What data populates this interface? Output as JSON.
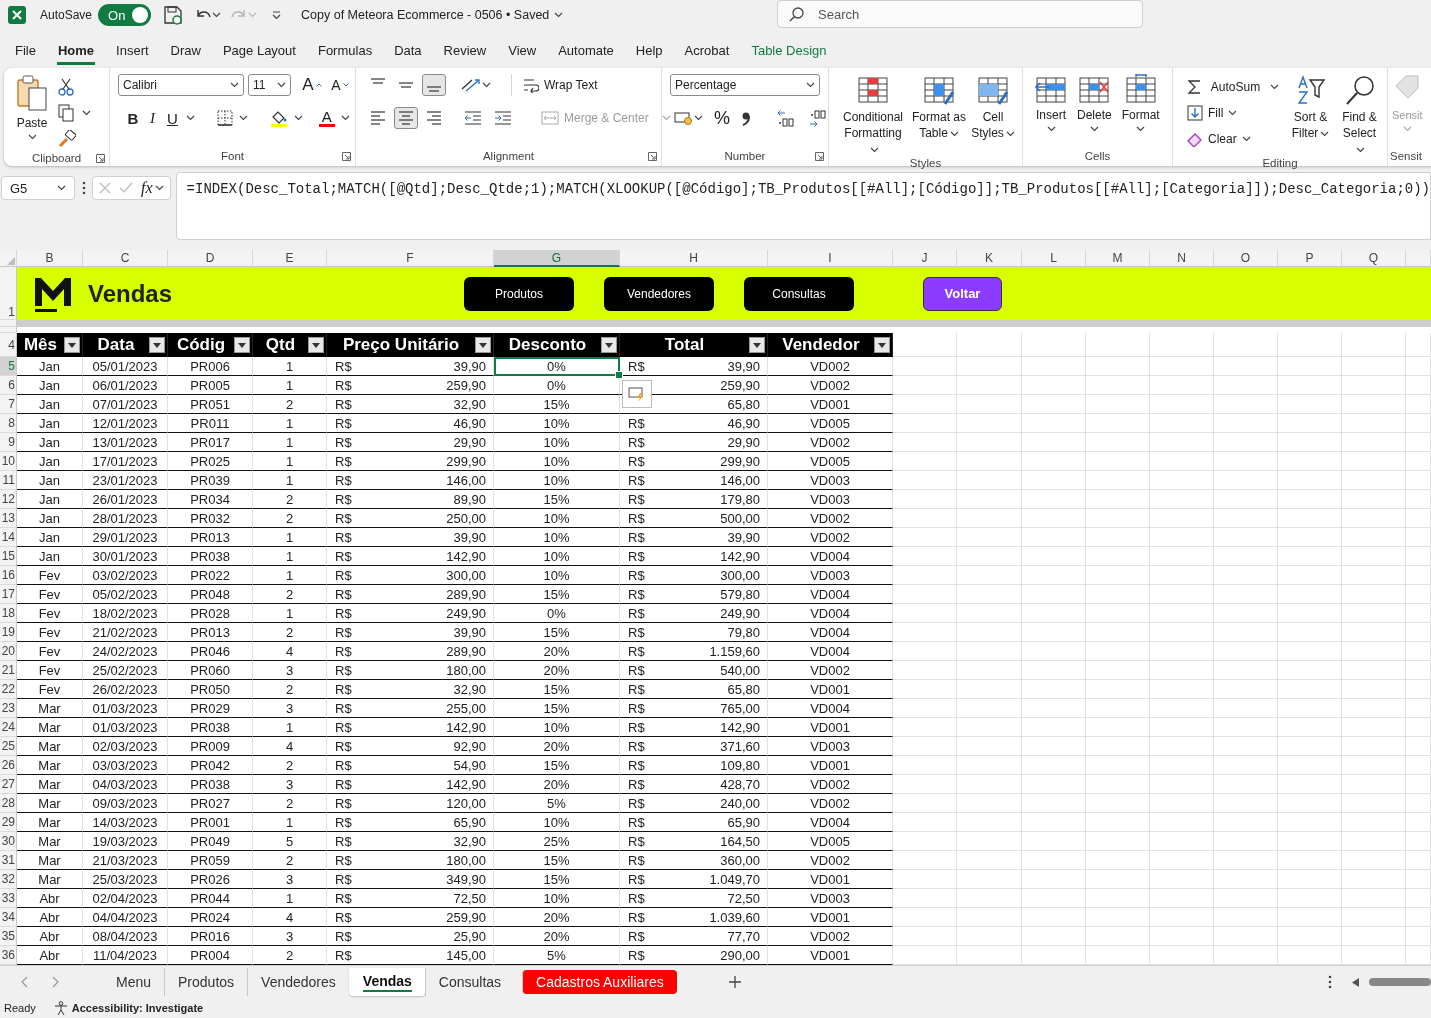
{
  "title_bar": {
    "app_label": "AutoSave",
    "autosave_on": true,
    "autosave_state": "On",
    "redo_disabled": true,
    "document_title": "Copy of Meteora Ecommerce - 0506 • Saved",
    "search": {
      "placeholder": "Search"
    }
  },
  "ribbon_tabs": [
    {
      "label": "File",
      "selected": false,
      "kind": "standard"
    },
    {
      "label": "Home",
      "selected": true,
      "kind": "standard"
    },
    {
      "label": "Insert",
      "selected": false,
      "kind": "standard"
    },
    {
      "label": "Draw",
      "selected": false,
      "kind": "standard"
    },
    {
      "label": "Page Layout",
      "selected": false,
      "kind": "standard"
    },
    {
      "label": "Formulas",
      "selected": false,
      "kind": "standard"
    },
    {
      "label": "Data",
      "selected": false,
      "kind": "standard"
    },
    {
      "label": "Review",
      "selected": false,
      "kind": "standard"
    },
    {
      "label": "View",
      "selected": false,
      "kind": "standard"
    },
    {
      "label": "Automate",
      "selected": false,
      "kind": "standard"
    },
    {
      "label": "Help",
      "selected": false,
      "kind": "standard"
    },
    {
      "label": "Acrobat",
      "selected": false,
      "kind": "standard"
    },
    {
      "label": "Table Design",
      "selected": false,
      "kind": "contextual"
    }
  ],
  "ribbon": {
    "clipboard": {
      "label": "Clipboard",
      "paste": "Paste"
    },
    "font": {
      "label": "Font",
      "font_name": "Calibri",
      "font_size": "11",
      "grow": "A",
      "shrink": "A",
      "styles": [
        "B",
        "I",
        "U"
      ],
      "font_color": "A"
    },
    "alignment": {
      "label": "Alignment",
      "vertical": [
        {
          "selected": false
        },
        {
          "selected": false
        },
        {
          "selected": true
        }
      ],
      "horizontal": [
        {
          "selected": false
        },
        {
          "selected": true
        },
        {
          "selected": false
        }
      ],
      "wrap_text": "Wrap Text",
      "merge_center": "Merge & Center",
      "merge_disabled": true
    },
    "number": {
      "label": "Number",
      "format": "Percentage",
      "percent": "%"
    },
    "styles": {
      "label": "Styles",
      "buttons": [
        "Conditional Formatting",
        "Format as Table",
        "Cell Styles"
      ]
    },
    "cells": {
      "label": "Cells",
      "buttons": [
        "Insert",
        "Delete",
        "Format"
      ]
    },
    "editing": {
      "label": "Editing",
      "small_buttons": [
        "AutoSum",
        "Fill",
        "Clear"
      ],
      "buttons": [
        "Sort & Filter",
        "Find & Select"
      ]
    },
    "sensitivity": {
      "label": "Sensit",
      "button": "Sensit",
      "disabled": true
    }
  },
  "formula_bar": {
    "name_box": "G5",
    "fx": "fx",
    "formula": "=INDEX(Desc_Total;MATCH([@Qtd];Desc_Qtde;1);MATCH(XLOOKUP([@Código];TB_Produtos[[#All];[Código]];TB_Produtos[[#All];[Categoria]]);Desc_Categoria;0))"
  },
  "columns": [
    {
      "letter": "B",
      "selected": false
    },
    {
      "letter": "C",
      "selected": false
    },
    {
      "letter": "D",
      "selected": false
    },
    {
      "letter": "E",
      "selected": false
    },
    {
      "letter": "F",
      "selected": false
    },
    {
      "letter": "G",
      "selected": true
    },
    {
      "letter": "H",
      "selected": false
    },
    {
      "letter": "I",
      "selected": false
    },
    {
      "letter": "J",
      "selected": false
    },
    {
      "letter": "K",
      "selected": false
    },
    {
      "letter": "L",
      "selected": false
    },
    {
      "letter": "M",
      "selected": false
    },
    {
      "letter": "N",
      "selected": false
    },
    {
      "letter": "O",
      "selected": false
    },
    {
      "letter": "P",
      "selected": false
    },
    {
      "letter": "Q",
      "selected": false
    }
  ],
  "banner": {
    "row": "1",
    "title": "Vendas",
    "buttons": [
      {
        "label": "Produtos",
        "kind": "nav"
      },
      {
        "label": "Vendedores",
        "kind": "nav"
      },
      {
        "label": "Consultas",
        "kind": "nav"
      },
      {
        "label": "Voltar",
        "kind": "back"
      }
    ]
  },
  "table": {
    "header_row": "4",
    "headers": [
      "Mês",
      "Data",
      "Códig",
      "Qtd",
      "Preço Unitário",
      "Desconto",
      "Total",
      "Vendedor"
    ],
    "rows": [
      {
        "row": "5",
        "month": "Jan",
        "date": "05/01/2023",
        "code": "PR006",
        "qty": "1",
        "price_currency": "R$",
        "price": "39,90",
        "discount": "0%",
        "total_currency": "R$",
        "total": "39,90",
        "seller": "VD002",
        "selected": true
      },
      {
        "row": "6",
        "month": "Jan",
        "date": "06/01/2023",
        "code": "PR005",
        "qty": "1",
        "price_currency": "R$",
        "price": "259,90",
        "discount": "0%",
        "total": "259,90",
        "seller": "VD002",
        "selected": false
      },
      {
        "row": "7",
        "month": "Jan",
        "date": "07/01/2023",
        "code": "PR051",
        "qty": "2",
        "price_currency": "R$",
        "price": "32,90",
        "discount": "15%",
        "total": "65,80",
        "seller": "VD001",
        "selected": false
      },
      {
        "row": "8",
        "month": "Jan",
        "date": "12/01/2023",
        "code": "PR011",
        "qty": "1",
        "price_currency": "R$",
        "price": "46,90",
        "discount": "10%",
        "total_currency": "R$",
        "total": "46,90",
        "seller": "VD005",
        "selected": false
      },
      {
        "row": "9",
        "month": "Jan",
        "date": "13/01/2023",
        "code": "PR017",
        "qty": "1",
        "price_currency": "R$",
        "price": "29,90",
        "discount": "10%",
        "total_currency": "R$",
        "total": "29,90",
        "seller": "VD002",
        "selected": false
      },
      {
        "row": "10",
        "month": "Jan",
        "date": "17/01/2023",
        "code": "PR025",
        "qty": "1",
        "price_currency": "R$",
        "price": "299,90",
        "discount": "10%",
        "total_currency": "R$",
        "total": "299,90",
        "seller": "VD005",
        "selected": false
      },
      {
        "row": "11",
        "month": "Jan",
        "date": "23/01/2023",
        "code": "PR039",
        "qty": "1",
        "price_currency": "R$",
        "price": "146,00",
        "discount": "10%",
        "total_currency": "R$",
        "total": "146,00",
        "seller": "VD003",
        "selected": false
      },
      {
        "row": "12",
        "month": "Jan",
        "date": "26/01/2023",
        "code": "PR034",
        "qty": "2",
        "price_currency": "R$",
        "price": "89,90",
        "discount": "15%",
        "total_currency": "R$",
        "total": "179,80",
        "seller": "VD003",
        "selected": false
      },
      {
        "row": "13",
        "month": "Jan",
        "date": "28/01/2023",
        "code": "PR032",
        "qty": "2",
        "price_currency": "R$",
        "price": "250,00",
        "discount": "10%",
        "total_currency": "R$",
        "total": "500,00",
        "seller": "VD002",
        "selected": false
      },
      {
        "row": "14",
        "month": "Jan",
        "date": "29/01/2023",
        "code": "PR013",
        "qty": "1",
        "price_currency": "R$",
        "price": "39,90",
        "discount": "10%",
        "total_currency": "R$",
        "total": "39,90",
        "seller": "VD002",
        "selected": false
      },
      {
        "row": "15",
        "month": "Jan",
        "date": "30/01/2023",
        "code": "PR038",
        "qty": "1",
        "price_currency": "R$",
        "price": "142,90",
        "discount": "10%",
        "total_currency": "R$",
        "total": "142,90",
        "seller": "VD004",
        "selected": false
      },
      {
        "row": "16",
        "month": "Fev",
        "date": "03/02/2023",
        "code": "PR022",
        "qty": "1",
        "price_currency": "R$",
        "price": "300,00",
        "discount": "10%",
        "total_currency": "R$",
        "total": "300,00",
        "seller": "VD003",
        "selected": false
      },
      {
        "row": "17",
        "month": "Fev",
        "date": "05/02/2023",
        "code": "PR048",
        "qty": "2",
        "price_currency": "R$",
        "price": "289,90",
        "discount": "15%",
        "total_currency": "R$",
        "total": "579,80",
        "seller": "VD004",
        "selected": false
      },
      {
        "row": "18",
        "month": "Fev",
        "date": "18/02/2023",
        "code": "PR028",
        "qty": "1",
        "price_currency": "R$",
        "price": "249,90",
        "discount": "0%",
        "total_currency": "R$",
        "total": "249,90",
        "seller": "VD004",
        "selected": false
      },
      {
        "row": "19",
        "month": "Fev",
        "date": "21/02/2023",
        "code": "PR013",
        "qty": "2",
        "price_currency": "R$",
        "price": "39,90",
        "discount": "15%",
        "total_currency": "R$",
        "total": "79,80",
        "seller": "VD004",
        "selected": false
      },
      {
        "row": "20",
        "month": "Fev",
        "date": "24/02/2023",
        "code": "PR046",
        "qty": "4",
        "price_currency": "R$",
        "price": "289,90",
        "discount": "20%",
        "total_currency": "R$",
        "total": "1.159,60",
        "seller": "VD004",
        "selected": false
      },
      {
        "row": "21",
        "month": "Fev",
        "date": "25/02/2023",
        "code": "PR060",
        "qty": "3",
        "price_currency": "R$",
        "price": "180,00",
        "discount": "20%",
        "total_currency": "R$",
        "total": "540,00",
        "seller": "VD002",
        "selected": false
      },
      {
        "row": "22",
        "month": "Fev",
        "date": "26/02/2023",
        "code": "PR050",
        "qty": "2",
        "price_currency": "R$",
        "price": "32,90",
        "discount": "15%",
        "total_currency": "R$",
        "total": "65,80",
        "seller": "VD001",
        "selected": false
      },
      {
        "row": "23",
        "month": "Mar",
        "date": "01/03/2023",
        "code": "PR029",
        "qty": "3",
        "price_currency": "R$",
        "price": "255,00",
        "discount": "15%",
        "total_currency": "R$",
        "total": "765,00",
        "seller": "VD004",
        "selected": false
      },
      {
        "row": "24",
        "month": "Mar",
        "date": "01/03/2023",
        "code": "PR038",
        "qty": "1",
        "price_currency": "R$",
        "price": "142,90",
        "discount": "10%",
        "total_currency": "R$",
        "total": "142,90",
        "seller": "VD001",
        "selected": false
      },
      {
        "row": "25",
        "month": "Mar",
        "date": "02/03/2023",
        "code": "PR009",
        "qty": "4",
        "price_currency": "R$",
        "price": "92,90",
        "discount": "20%",
        "total_currency": "R$",
        "total": "371,60",
        "seller": "VD003",
        "selected": false
      },
      {
        "row": "26",
        "month": "Mar",
        "date": "03/03/2023",
        "code": "PR042",
        "qty": "2",
        "price_currency": "R$",
        "price": "54,90",
        "discount": "15%",
        "total_currency": "R$",
        "total": "109,80",
        "seller": "VD001",
        "selected": false
      },
      {
        "row": "27",
        "month": "Mar",
        "date": "04/03/2023",
        "code": "PR038",
        "qty": "3",
        "price_currency": "R$",
        "price": "142,90",
        "discount": "20%",
        "total_currency": "R$",
        "total": "428,70",
        "seller": "VD002",
        "selected": false
      },
      {
        "row": "28",
        "month": "Mar",
        "date": "09/03/2023",
        "code": "PR027",
        "qty": "2",
        "price_currency": "R$",
        "price": "120,00",
        "discount": "5%",
        "total_currency": "R$",
        "total": "240,00",
        "seller": "VD002",
        "selected": false
      },
      {
        "row": "29",
        "month": "Mar",
        "date": "14/03/2023",
        "code": "PR001",
        "qty": "1",
        "price_currency": "R$",
        "price": "65,90",
        "discount": "10%",
        "total_currency": "R$",
        "total": "65,90",
        "seller": "VD004",
        "selected": false
      },
      {
        "row": "30",
        "month": "Mar",
        "date": "19/03/2023",
        "code": "PR049",
        "qty": "5",
        "price_currency": "R$",
        "price": "32,90",
        "discount": "25%",
        "total_currency": "R$",
        "total": "164,50",
        "seller": "VD005",
        "selected": false
      },
      {
        "row": "31",
        "month": "Mar",
        "date": "21/03/2023",
        "code": "PR059",
        "qty": "2",
        "price_currency": "R$",
        "price": "180,00",
        "discount": "15%",
        "total_currency": "R$",
        "total": "360,00",
        "seller": "VD002",
        "selected": false
      },
      {
        "row": "32",
        "month": "Mar",
        "date": "25/03/2023",
        "code": "PR026",
        "qty": "3",
        "price_currency": "R$",
        "price": "349,90",
        "discount": "15%",
        "total_currency": "R$",
        "total": "1.049,70",
        "seller": "VD001",
        "selected": false
      },
      {
        "row": "33",
        "month": "Abr",
        "date": "02/04/2023",
        "code": "PR044",
        "qty": "1",
        "price_currency": "R$",
        "price": "72,50",
        "discount": "10%",
        "total_currency": "R$",
        "total": "72,50",
        "seller": "VD003",
        "selected": false
      },
      {
        "row": "34",
        "month": "Abr",
        "date": "04/04/2023",
        "code": "PR024",
        "qty": "4",
        "price_currency": "R$",
        "price": "259,90",
        "discount": "20%",
        "total_currency": "R$",
        "total": "1.039,60",
        "seller": "VD001",
        "selected": false
      },
      {
        "row": "35",
        "month": "Abr",
        "date": "08/04/2023",
        "code": "PR016",
        "qty": "3",
        "price_currency": "R$",
        "price": "25,90",
        "discount": "20%",
        "total_currency": "R$",
        "total": "77,70",
        "seller": "VD002",
        "selected": false
      },
      {
        "row": "36",
        "month": "Abr",
        "date": "11/04/2023",
        "code": "PR004",
        "qty": "2",
        "price_currency": "R$",
        "price": "145,00",
        "discount": "5%",
        "total_currency": "R$",
        "total": "290,00",
        "seller": "VD001",
        "selected": false
      }
    ]
  },
  "sheet_tabs": [
    {
      "label": "Menu",
      "selected": false
    },
    {
      "label": "Produtos",
      "selected": false
    },
    {
      "label": "Vendedores",
      "selected": false
    },
    {
      "label": "Vendas",
      "selected": true
    },
    {
      "label": "Consultas",
      "selected": false
    },
    {
      "label": "Cadastros Auxiliares",
      "selected": false,
      "color": "#ff0000"
    }
  ],
  "status_bar": {
    "status": "Ready",
    "accessibility": "Accessibility: Investigate"
  }
}
